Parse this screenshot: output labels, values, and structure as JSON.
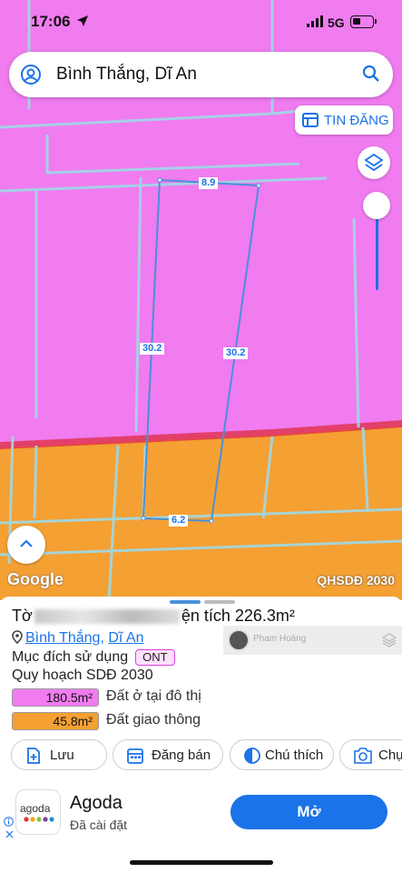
{
  "status_bar": {
    "time": "17:06",
    "network": "5G"
  },
  "search": {
    "query": "Bình Thắng, Dĩ An"
  },
  "map": {
    "tin_dang_label": "TIN ĐĂNG",
    "google_logo": "Google",
    "layer_name": "QHSDĐ 2030",
    "dimensions": {
      "top": "8.9",
      "left": "30.2",
      "right": "30.2",
      "bottom": "6.2"
    },
    "colors": {
      "residential": "#f07cf0",
      "traffic": "#f5a033",
      "boundary": "#4a90d9"
    }
  },
  "sheet": {
    "title_prefix": "Tờ",
    "title_suffix": "ện tích 226.3m²",
    "address_ward": "Bình Thắng",
    "address_sep": ",",
    "address_city": "Dĩ An",
    "purpose_label": "Mục đích sử dụng",
    "purpose_code": "ONT",
    "plan_title": "Quy hoạch SDĐ 2030",
    "usages": [
      {
        "area": "180.5m²",
        "label": "Đất ở tại đô thị",
        "color": "#f07cf0"
      },
      {
        "area": "45.8m²",
        "label": "Đất giao thông",
        "color": "#f5a033"
      }
    ],
    "watermark_name": "Pham Hoàng",
    "actions": [
      {
        "label": "Lưu",
        "icon": "add-document-icon"
      },
      {
        "label": "Đăng bán",
        "icon": "calendar-icon"
      },
      {
        "label": "Chú thích",
        "icon": "contrast-icon"
      },
      {
        "label": "Chụ",
        "icon": "camera-icon"
      }
    ]
  },
  "ad": {
    "logo_text": "agoda",
    "title": "Agoda",
    "subtitle": "Đã cài đặt",
    "button": "Mở"
  }
}
